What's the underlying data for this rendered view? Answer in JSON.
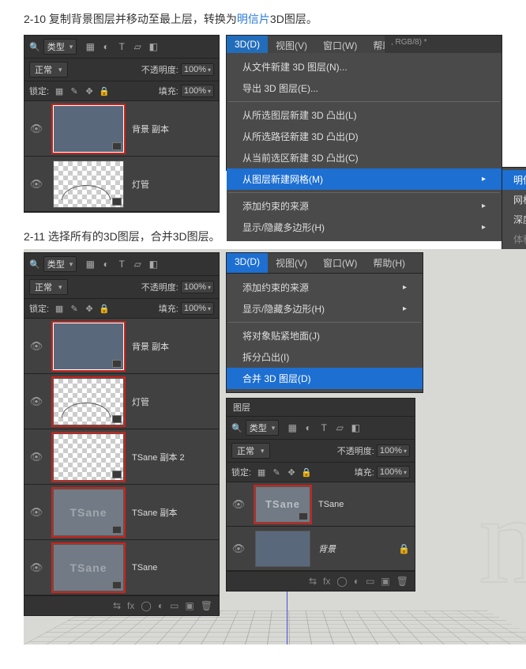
{
  "step1": {
    "caption_pre": "2-10 复制背景图层并移动至最上层，转换为",
    "caption_hl": "明信片",
    "caption_post": "3D图层。"
  },
  "step2": {
    "caption": "2-11 选择所有的3D图层，合并3D图层。"
  },
  "layers": {
    "filter_kind": "类型",
    "blend": "正常",
    "opacity_label": "不透明度:",
    "opacity_value": "100%",
    "lock_label": "锁定:",
    "fill_label": "填充:",
    "fill_value": "100%",
    "panel_title": "图层"
  },
  "layers1": [
    {
      "name": "背景 副本",
      "thumb": "solid",
      "sel": true
    },
    {
      "name": "灯管",
      "thumb": "checker"
    }
  ],
  "layers2": [
    {
      "name": "背景 副本",
      "thumb": "solid",
      "sel": true
    },
    {
      "name": "灯管",
      "thumb": "checker",
      "sel": true
    },
    {
      "name": "TSane 副本 2",
      "thumb": "checker",
      "sel": true
    },
    {
      "name": "TSane 副本",
      "thumb": "text",
      "text": "TSane",
      "sel": true
    },
    {
      "name": "TSane",
      "thumb": "text",
      "text": "TSane",
      "sel": true
    }
  ],
  "layers3": [
    {
      "name": "TSane",
      "thumb": "text",
      "text": "TSane",
      "sel": true
    },
    {
      "name": "背景",
      "thumb": "solid",
      "lock": true
    }
  ],
  "menubar": {
    "d3": "3D(D)",
    "view": "视图(V)",
    "window": "窗口(W)",
    "help": "帮助(H)"
  },
  "menu1": {
    "m1": "从文件新建 3D 图层(N)...",
    "m2": "导出 3D 图层(E)...",
    "m3": "从所选图层新建 3D 凸出(L)",
    "m4": "从所选路径新建 3D 凸出(D)",
    "m5": "从当前选区新建 3D 凸出(C)",
    "m6": "从图层新建网格(M)",
    "m7": "添加约束的来源",
    "m8": "显示/隐藏多边形(H)",
    "sub": {
      "s1": "明信片(P)",
      "s2": "网格预设(M)",
      "s3": "深度映射到(D)",
      "s4": "体积(V)..."
    }
  },
  "menu2": {
    "m1": "添加约束的来源",
    "m2": "显示/隐藏多边形(H)",
    "m3": "将对象贴紧地面(J)",
    "m4": "拆分凸出(I)",
    "m5": "合并 3D 图层(D)"
  },
  "doc": {
    "tab": ", RGB/8) *"
  }
}
